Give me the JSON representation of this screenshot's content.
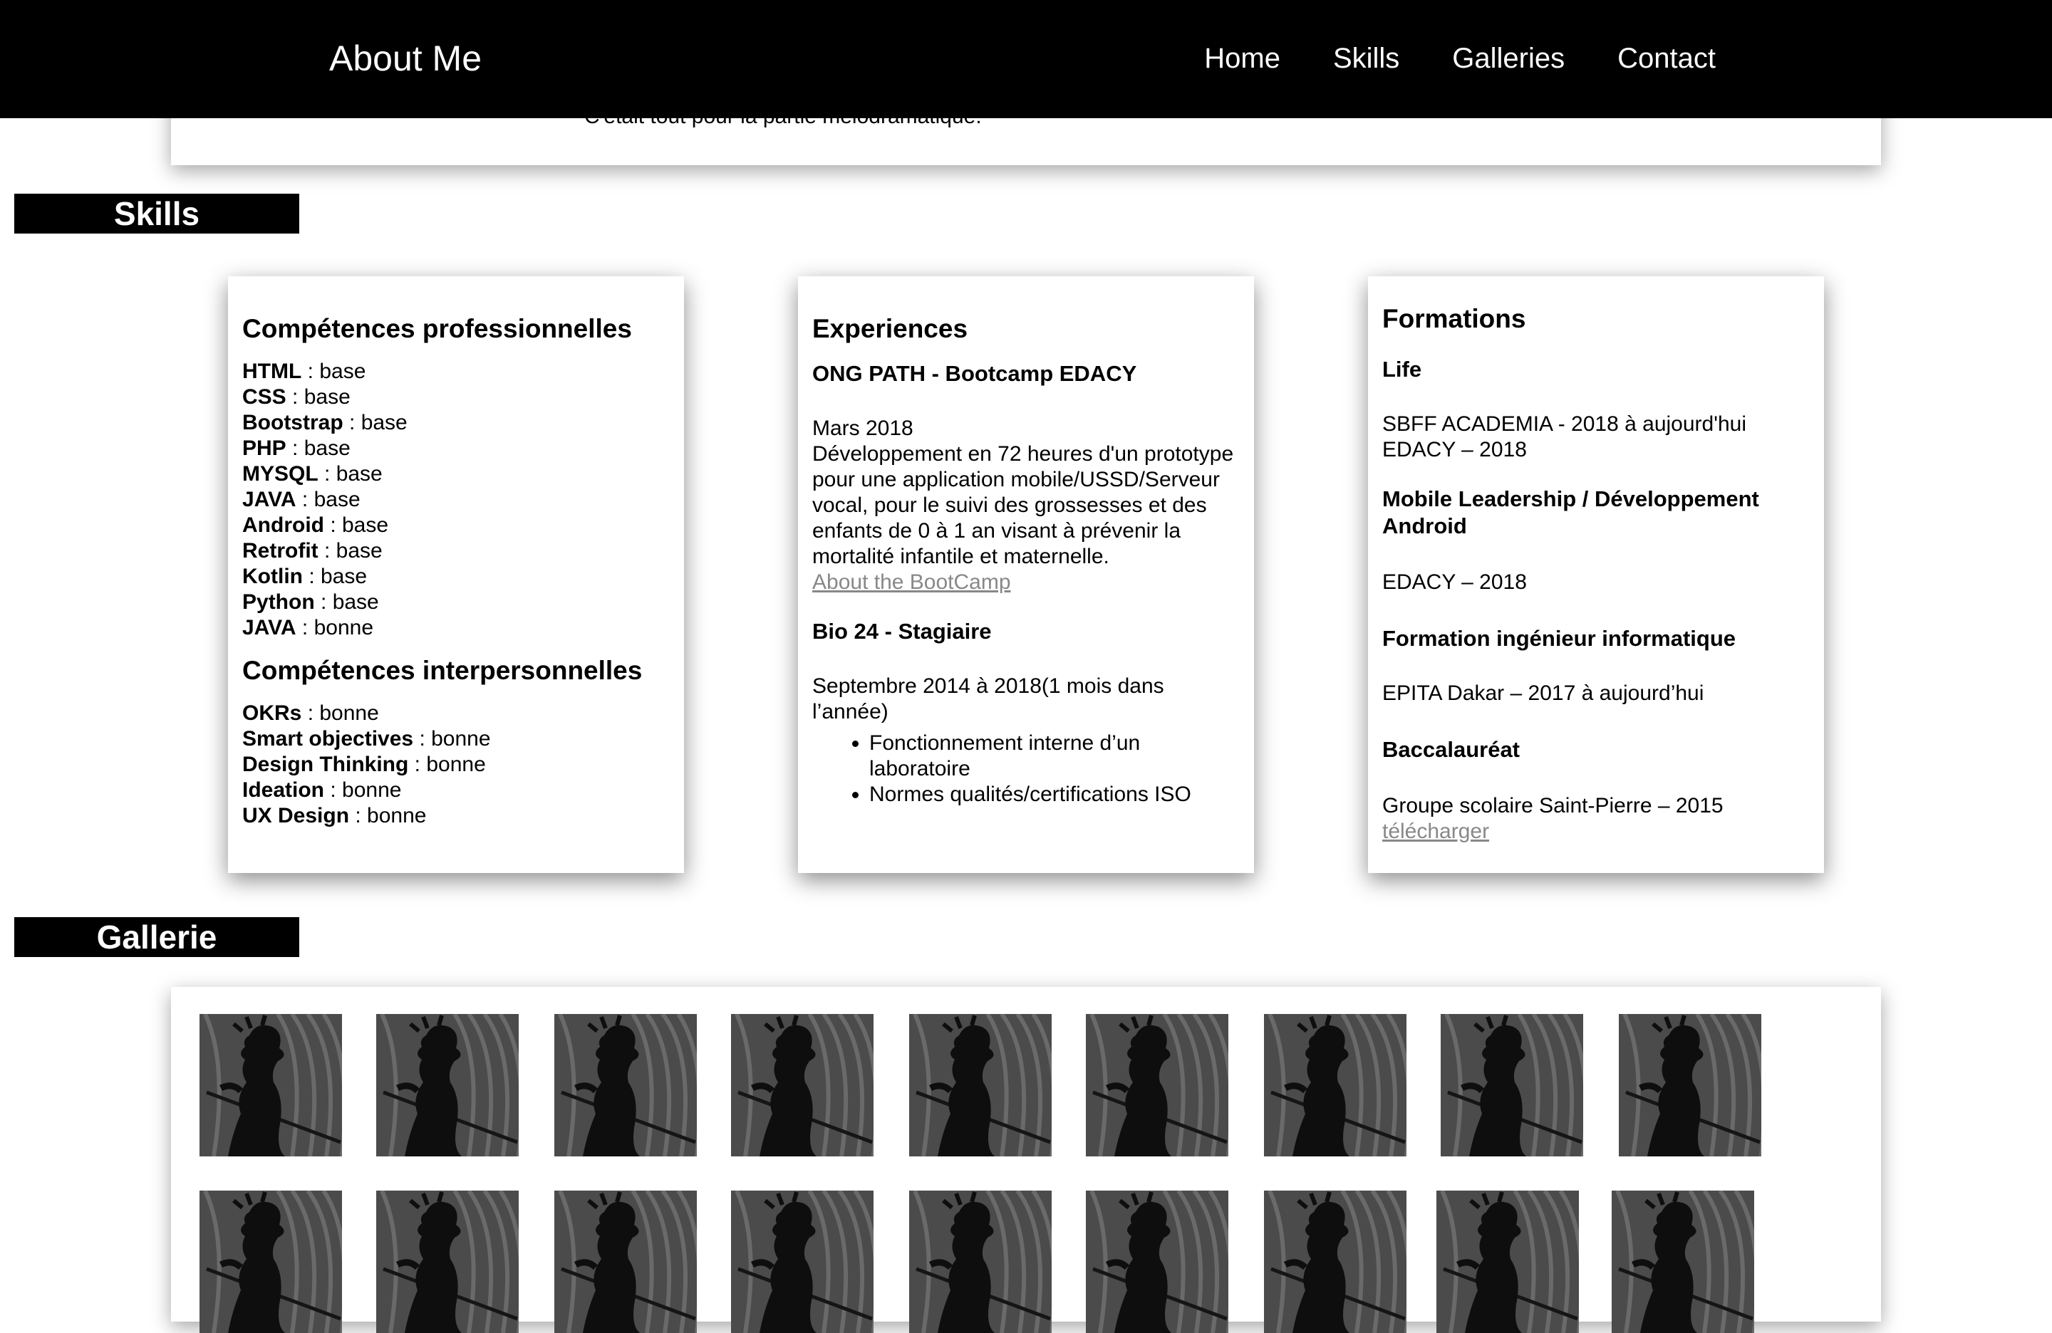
{
  "navbar": {
    "brand": "About Me",
    "links": [
      "Home",
      "Skills",
      "Galleries",
      "Contact"
    ]
  },
  "about": {
    "text": "C'était tout pour la partie mélodramatique."
  },
  "skills_section": {
    "heading": "Skills",
    "professional": {
      "title": "Compétences professionnelles",
      "items": [
        {
          "name": "HTML",
          "level": "base"
        },
        {
          "name": "CSS",
          "level": "base"
        },
        {
          "name": "Bootstrap",
          "level": "base"
        },
        {
          "name": "PHP",
          "level": "base"
        },
        {
          "name": "MYSQL",
          "level": "base"
        },
        {
          "name": "JAVA",
          "level": "base"
        },
        {
          "name": "Android",
          "level": "base"
        },
        {
          "name": "Retrofit",
          "level": "base"
        },
        {
          "name": "Kotlin",
          "level": "base"
        },
        {
          "name": "Python",
          "level": "base"
        },
        {
          "name": "JAVA",
          "level": "bonne"
        }
      ]
    },
    "interpersonal": {
      "title": "Compétences interpersonnelles",
      "items": [
        {
          "name": "OKRs",
          "level": "bonne"
        },
        {
          "name": "Smart objectives",
          "level": "bonne"
        },
        {
          "name": "Design Thinking",
          "level": "bonne"
        },
        {
          "name": "Ideation",
          "level": "bonne"
        },
        {
          "name": "UX Design",
          "level": "bonne"
        }
      ]
    },
    "experiences": {
      "title": "Experiences",
      "job1_title": "ONG PATH - Bootcamp EDACY",
      "job1_date": "Mars 2018",
      "job1_desc": "Développement en 72 heures d'un prototype pour une application mobile/USSD/Serveur vocal, pour le suivi des grossesses et des enfants de 0 à 1 an visant à prévenir la mortalité infantile et maternelle.",
      "job1_link": "About the BootCamp",
      "job2_title": "Bio 24 - Stagiaire",
      "job2_date": "Septembre 2014 à 2018(1 mois dans l’année)",
      "job2_bullets": [
        "Fonctionnement interne d’un laboratoire",
        "Normes qualités/certifications ISO"
      ]
    },
    "formations": {
      "title": "Formations",
      "f1_title": "Life",
      "f1_line1": "SBFF ACADEMIA - 2018 à aujourd'hui",
      "f1_line2": "EDACY – 2018",
      "f2_title": "Mobile Leadership / Développement Android",
      "f2_line": "EDACY – 2018",
      "f3_title": "Formation ingénieur informatique",
      "f3_line": "EPITA Dakar – 2017 à aujourd’hui",
      "f4_title": "Baccalauréat",
      "f4_line": "Groupe scolaire Saint-Pierre – 2015",
      "download_link": "télécharger"
    }
  },
  "gallery_section": {
    "heading": "Gallerie",
    "thumbnail_count_visible": 18
  },
  "colors": {
    "navbar_bg": "#000000",
    "heading_bg": "#000000",
    "link_gray": "#888888",
    "page_bg": "#ffffff"
  }
}
